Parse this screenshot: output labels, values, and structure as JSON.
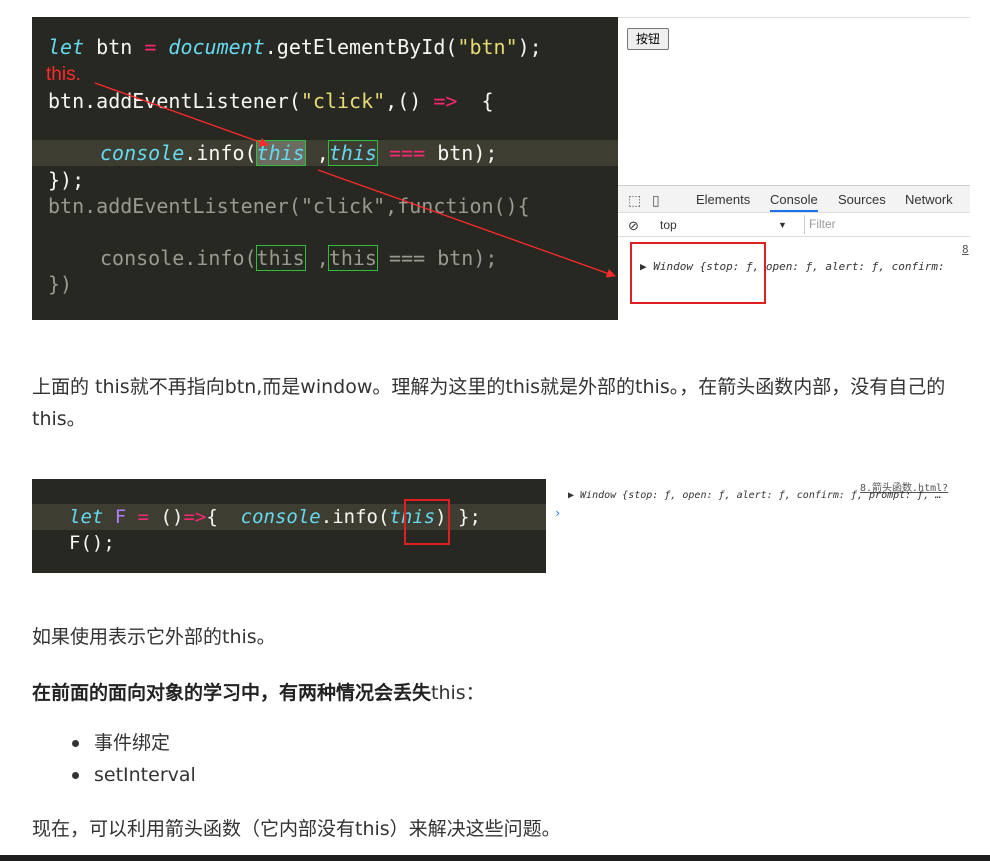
{
  "figure1": {
    "annotation": "this.",
    "code_lines": [
      {
        "kw": "let",
        "rest1": " btn ",
        "op": "=",
        "obj": " document",
        "rest2": ".getElementById(",
        "str": "\"btn\"",
        "rest3": ");"
      },
      {
        "a": "btn.addEventListener(",
        "str": "\"click\"",
        "b": ",() ",
        "op": "=>",
        "c": "  {"
      },
      {
        "kw": "console",
        "a": ".info(",
        "this1": "this",
        "b": " ,",
        "this2": "this",
        "op": " ===",
        "c": " btn);"
      },
      {
        "text": "});"
      },
      {
        "a": "btn.addEventListener(",
        "str": "\"click\"",
        "b": ",function(){"
      },
      {
        "kw": "console",
        "a": ".info(",
        "this1": "this",
        "b": " ,",
        "this2": "this",
        "c": " === btn);"
      },
      {
        "text": "})"
      }
    ],
    "page_button": "按钮",
    "devtools": {
      "tabs": [
        "Elements",
        "Console",
        "Sources",
        "Network"
      ],
      "active_tab": "Console",
      "context": "top",
      "filter_placeholder": "Filter",
      "source_link": "8",
      "log": "▶ Window {stop: ƒ, open: ƒ, alert: ƒ, confirm:"
    }
  },
  "paragraph1": "上面的 this就不再指向btn,而是window。理解为这里的this就是外部的this。，在箭头函数内部，没有自己的this。",
  "figure2": {
    "code": {
      "kw": "let",
      "name": " F",
      "op": " =",
      "args": " ()",
      "arrow": "=>",
      "brace": "{",
      "console": "console",
      "info": ".info(",
      "this": "this",
      "end": ") };",
      "call": "F();"
    },
    "source_link": "8.箭头函数.html?",
    "log": "▶ Window {stop: ƒ, open: ƒ, alert: ƒ, confirm: ƒ, prompt: ƒ, …",
    "prompt": "›"
  },
  "paragraph2": "如果使用表示它外部的this。",
  "paragraph3_bold": "在前面的面向对象的学习中，有两种情况会丢失",
  "paragraph3_rest": "this：",
  "bullets": [
    "事件绑定",
    "setInterval"
  ],
  "paragraph4": "现在，可以利用箭头函数（它内部没有this）来解决这些问题。",
  "colors": {
    "editor_bg": "#272822",
    "keyword": "#66d9ef",
    "operator": "#f92672",
    "string": "#e6db74",
    "annotation_red": "#ff2a2a",
    "highlight_green": "#2fbf3a"
  }
}
